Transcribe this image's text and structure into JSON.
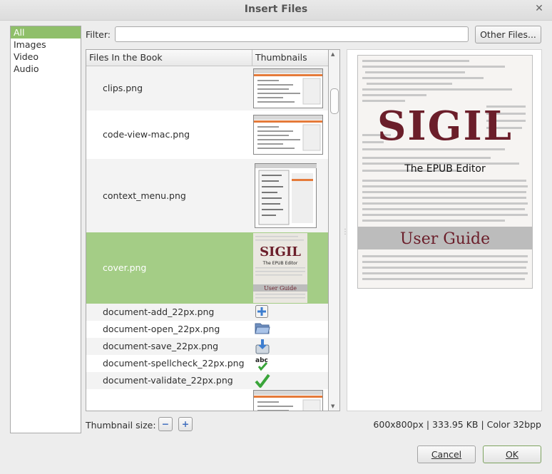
{
  "window": {
    "title": "Insert Files"
  },
  "types": [
    "All",
    "Images",
    "Video",
    "Audio"
  ],
  "filter": {
    "label": "Filter:",
    "value": "",
    "other_button": "Other Files..."
  },
  "table": {
    "columns": [
      "Files In the Book",
      "Thumbnails"
    ],
    "rows": [
      {
        "name": "clips.png",
        "thumb": "screenshot"
      },
      {
        "name": "code-view-mac.png",
        "thumb": "screenshot"
      },
      {
        "name": "context_menu.png",
        "thumb": "menu"
      },
      {
        "name": "cover.png",
        "thumb": "cover",
        "selected": true
      },
      {
        "name": "document-add_22px.png",
        "thumb": "add-icon"
      },
      {
        "name": "document-open_22px.png",
        "thumb": "folder-icon"
      },
      {
        "name": "document-save_22px.png",
        "thumb": "save-icon"
      },
      {
        "name": "document-spellcheck_22px.png",
        "thumb": "spellcheck-icon"
      },
      {
        "name": "document-validate_22px.png",
        "thumb": "check-icon"
      },
      {
        "name": "",
        "thumb": "screenshot"
      }
    ]
  },
  "thumbnail_size": {
    "label": "Thumbnail size:",
    "decrease": "−",
    "increase": "+"
  },
  "image_info": "600x800px | 333.95 KB | Color 32bpp",
  "cover": {
    "title": "SIGIL",
    "subtitle": "The EPUB Editor",
    "banner": "User Guide",
    "thumb_subtitle": "The EPUB Editor"
  },
  "buttons": {
    "cancel": "Cancel",
    "ok": "OK"
  },
  "colors": {
    "selection": "#8fbf6a",
    "cover_title": "#6b1e2a",
    "banner": "#bcbcbc"
  }
}
